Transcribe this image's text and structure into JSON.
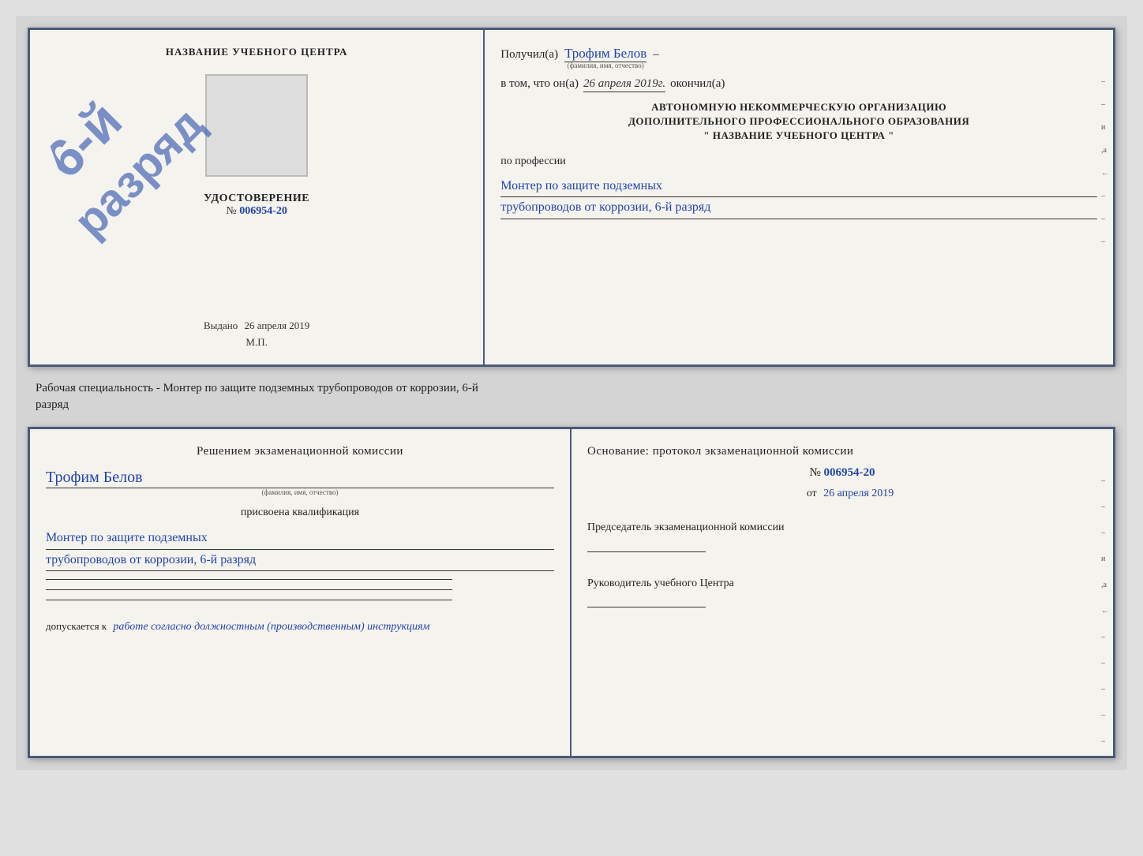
{
  "top_doc": {
    "left": {
      "org_name": "НАЗВАНИЕ УЧЕБНОГО ЦЕНТРА",
      "stamp_placeholder": "",
      "stamp_diagonal": "6-й разряд",
      "cert_title": "УДОСТОВЕРЕНИЕ",
      "cert_number_prefix": "№",
      "cert_number": "006954-20",
      "issued_label": "Выдано",
      "issued_date": "26 апреля 2019",
      "mp_label": "М.П."
    },
    "right": {
      "received_label": "Получил(а)",
      "recipient_name": "Трофим Белов",
      "recipient_name_sub": "(фамилия, имя, отчество)",
      "dash": "–",
      "in_that_label": "в том, что он(а)",
      "completion_date": "26 апреля 2019г.",
      "finished_label": "окончил(а)",
      "org_line1": "АВТОНОМНУЮ НЕКОММЕРЧЕСКУЮ ОРГАНИЗАЦИЮ",
      "org_line2": "ДОПОЛНИТЕЛЬНОГО ПРОФЕССИОНАЛЬНОГО ОБРАЗОВАНИЯ",
      "org_name_quotes": "\"   НАЗВАНИЕ УЧЕБНОГО ЦЕНТРА   \"",
      "profession_label": "по профессии",
      "profession_line1": "Монтер по защите подземных",
      "profession_line2": "трубопроводов от коррозии, 6-й разряд",
      "side_chars": [
        "–",
        "–",
        "и",
        ",а",
        "←",
        "–",
        "–",
        "–"
      ]
    }
  },
  "middle_text": {
    "line1": "Рабочая специальность - Монтер по защите подземных трубопроводов от коррозии, 6-й",
    "line2": "разряд"
  },
  "bottom_doc": {
    "left": {
      "decision_title": "Решением экзаменационной комиссии",
      "person_name": "Трофим Белов",
      "name_sub": "(фамилия, имя, отчество)",
      "assigned_label": "присвоена квалификация",
      "qualification_line1": "Монтер по защите подземных",
      "qualification_line2": "трубопроводов от коррозии, 6-й разряд",
      "allowed_prefix": "допускается к",
      "allowed_text": "работе согласно должностным (производственным) инструкциям"
    },
    "right": {
      "basis_label": "Основание: протокол экзаменационной комиссии",
      "number_prefix": "№",
      "number_value": "006954-20",
      "from_prefix": "от",
      "from_date": "26 апреля 2019",
      "chair_title": "Председатель экзаменационной комиссии",
      "center_leader_title": "Руководитель учебного Центра",
      "side_chars": [
        "–",
        "–",
        "–",
        "и",
        ",а",
        "←",
        "–",
        "–",
        "–",
        "–",
        "–"
      ]
    }
  }
}
